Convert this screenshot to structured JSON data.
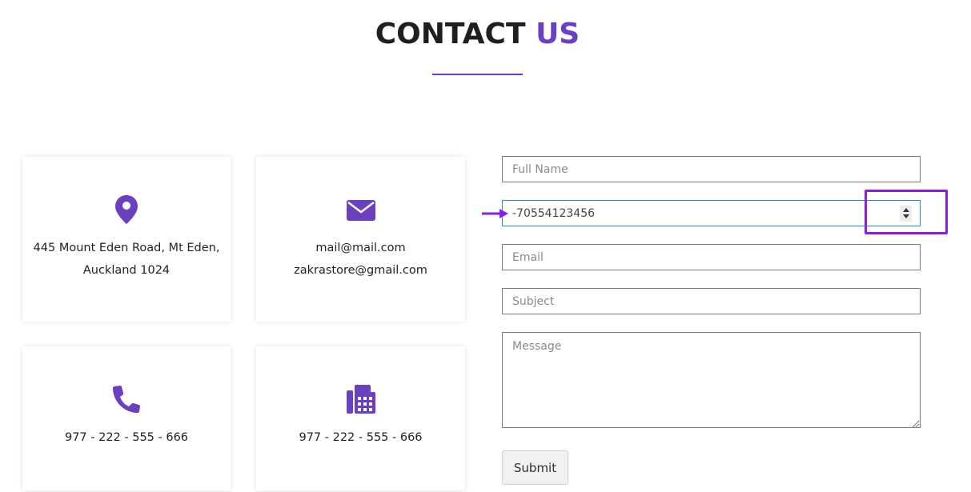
{
  "heading": {
    "part1": "CONTACT",
    "part2": "US"
  },
  "cards": {
    "address": {
      "line1": "445 Mount Eden Road, Mt Eden,",
      "line2": "Auckland 1024",
      "icon": "map-pin-icon"
    },
    "mail": {
      "line1": "mail@mail.com",
      "line2": "zakrastore@gmail.com",
      "icon": "envelope-icon"
    },
    "phone": {
      "line1": "977 - 222 - 555 - 666",
      "icon": "phone-icon"
    },
    "fax": {
      "line1": "977 - 222 - 555 - 666",
      "icon": "fax-icon"
    }
  },
  "form": {
    "full_name_placeholder": "Full Name",
    "phone_value": "-70554123456",
    "email_placeholder": "Email",
    "subject_placeholder": "Subject",
    "message_placeholder": "Message",
    "submit_label": "Submit"
  },
  "colors": {
    "accent": "#6a3fc0",
    "annotation": "#8a1ee8",
    "focus_border": "#2a8fbf"
  }
}
